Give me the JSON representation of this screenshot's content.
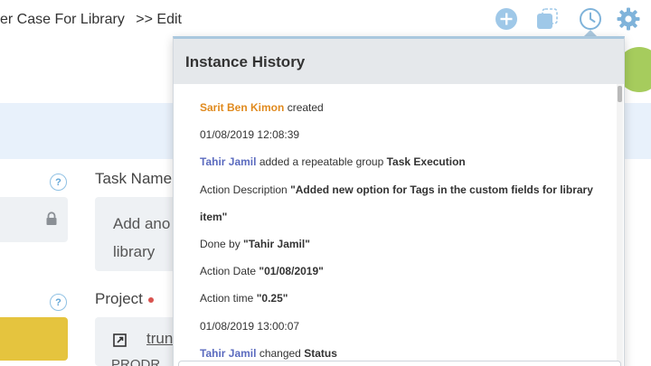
{
  "breadcrumb": {
    "title": "er Case For Library",
    "separator": ">>",
    "current": "Edit"
  },
  "toolbar": {
    "add_icon": "plus-circle-icon",
    "copy_icon": "copy-icon",
    "history_icon": "clock-icon",
    "settings_icon": "gear-icon"
  },
  "form": {
    "task_name_label": "Task Name",
    "task_name_value_line1": "Add ano",
    "task_name_value_line2": "library",
    "project_label": "Project",
    "project_link": "trun",
    "project_sub": "PRODR"
  },
  "history": {
    "title": "Instance History",
    "entries": [
      {
        "user": "Sarit Ben Kimon",
        "action": "created"
      },
      {
        "text": "01/08/2019 12:08:39"
      },
      {
        "user": "Tahir Jamil",
        "action": "added a repeatable group",
        "target": "Task Execution"
      },
      {
        "label": "Action Description",
        "value": "\"Added new option for Tags in the custom fields for library item\""
      },
      {
        "label": "Done by",
        "value": "\"Tahir Jamil\""
      },
      {
        "label": "Action Date",
        "value": "\"01/08/2019\""
      },
      {
        "label": "Action time",
        "value": "\"0.25\""
      },
      {
        "text": "01/08/2019 13:00:07"
      },
      {
        "user": "Tahir Jamil",
        "action": "changed",
        "target": "Status"
      }
    ]
  },
  "colors": {
    "accent_blue": "#5fa4d6",
    "user_orange": "#e08a1e",
    "user_blue": "#5b6bbf",
    "required_red": "#d9534f",
    "highlight_yellow": "#e5c43e",
    "status_green": "#a6cc5d"
  }
}
